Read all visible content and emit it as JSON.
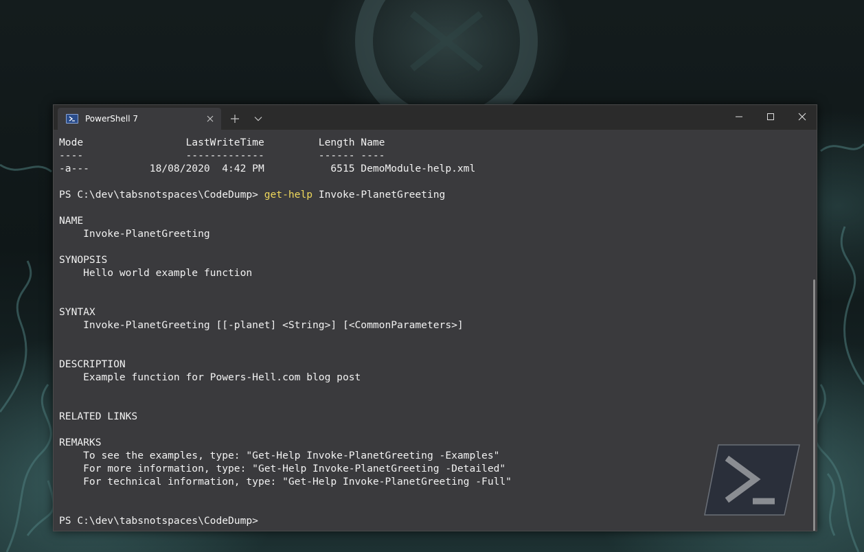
{
  "window": {
    "tab_title": "PowerShell 7",
    "icons": {
      "tab": "powershell-icon",
      "tab_close": "close-icon",
      "new_tab": "plus-icon",
      "dropdown": "chevron-down-icon",
      "minimize": "minimize-icon",
      "maximize": "maximize-icon",
      "close": "close-icon",
      "watermark": "powershell-logo"
    },
    "colors": {
      "terminal_bg": "#3a3a3d",
      "titlebar_bg": "#2b2b2b",
      "text": "#f2f2f2",
      "command": "#f0d95c"
    }
  },
  "terminal": {
    "lines": [
      {
        "text": "Mode                 LastWriteTime         Length Name"
      },
      {
        "text": "----                 -------------         ------ ----"
      },
      {
        "text": "-a---          18/08/2020  4:42 PM           6515 DemoModule-help.xml"
      },
      {
        "text": ""
      },
      {
        "prompt": "PS C:\\dev\\tabsnotspaces\\CodeDump> ",
        "command": "get-help",
        "args": " Invoke-PlanetGreeting"
      },
      {
        "text": ""
      },
      {
        "text": "NAME"
      },
      {
        "text": "    Invoke-PlanetGreeting"
      },
      {
        "text": ""
      },
      {
        "text": "SYNOPSIS"
      },
      {
        "text": "    Hello world example function"
      },
      {
        "text": ""
      },
      {
        "text": ""
      },
      {
        "text": "SYNTAX"
      },
      {
        "text": "    Invoke-PlanetGreeting [[-planet] <String>] [<CommonParameters>]"
      },
      {
        "text": ""
      },
      {
        "text": ""
      },
      {
        "text": "DESCRIPTION"
      },
      {
        "text": "    Example function for Powers-Hell.com blog post"
      },
      {
        "text": ""
      },
      {
        "text": ""
      },
      {
        "text": "RELATED LINKS"
      },
      {
        "text": ""
      },
      {
        "text": "REMARKS"
      },
      {
        "text": "    To see the examples, type: \"Get-Help Invoke-PlanetGreeting -Examples\""
      },
      {
        "text": "    For more information, type: \"Get-Help Invoke-PlanetGreeting -Detailed\""
      },
      {
        "text": "    For technical information, type: \"Get-Help Invoke-PlanetGreeting -Full\""
      },
      {
        "text": ""
      },
      {
        "text": ""
      },
      {
        "text": "PS C:\\dev\\tabsnotspaces\\CodeDump>"
      }
    ]
  }
}
